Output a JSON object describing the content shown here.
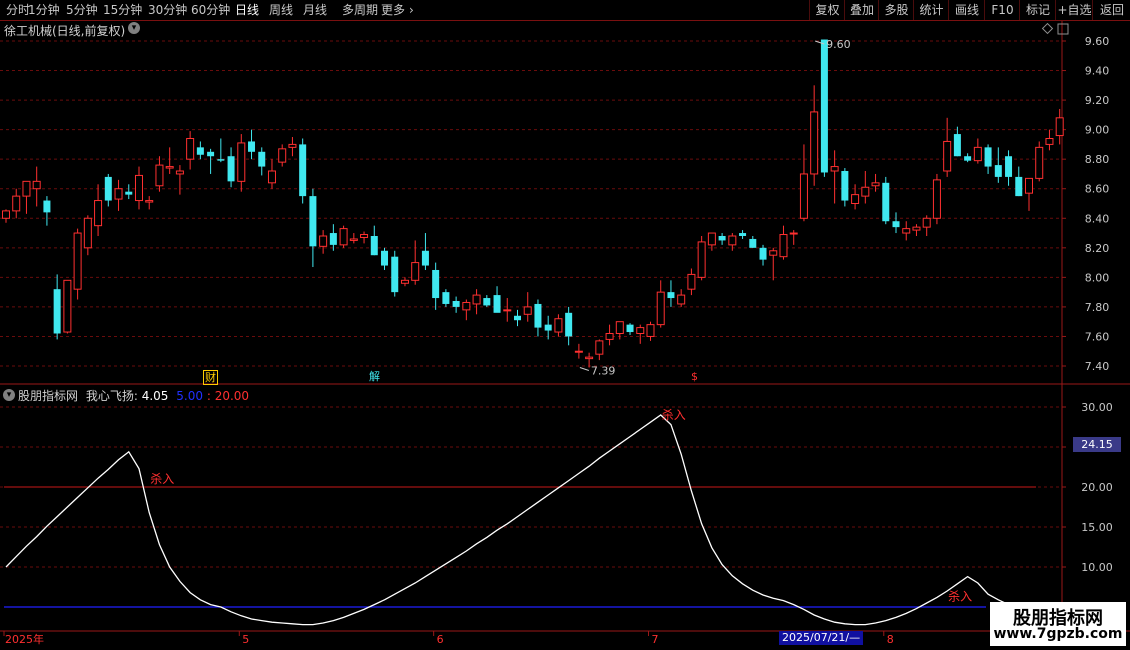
{
  "toolbar": {
    "periods": [
      "分时",
      "1分钟",
      "5分钟",
      "15分钟",
      "30分钟",
      "60分钟",
      "日线",
      "周线",
      "月线",
      "多周期",
      "更多"
    ],
    "active_period": "日线",
    "more_arrow": "›",
    "buttons": [
      "复权",
      "叠加",
      "多股",
      "统计",
      "画线",
      "F10",
      "标记",
      "+自选",
      "返回"
    ]
  },
  "stock_title": "徐工机械(日线,前复权)",
  "indicator": {
    "source": "股朋指标网",
    "name": "我心飞扬:",
    "value": "4.05",
    "param1": "5.00",
    "param2": "20.00",
    "current_value_badge": "24.15"
  },
  "watermark": {
    "line1": "股朋指标网",
    "line2": "www.7gpzb.com"
  },
  "pb_tags": {
    "cai": "财",
    "jie": "解",
    "s": "$"
  },
  "date_badge": "2025/07/21/—",
  "colors": {
    "up": "#ff3030",
    "down": "#40e8f0",
    "grid": "#6a0c0c",
    "axis": "#9a1818",
    "text": "#c8c8c8",
    "line": "#ffffff",
    "red_level": "#c81818",
    "blue_level": "#2020ff"
  },
  "chart_data": [
    {
      "type": "candlestick",
      "title": "徐工机械(日线,前复权)",
      "y_ticks": [
        7.4,
        7.6,
        7.8,
        8.0,
        8.2,
        8.4,
        8.6,
        8.8,
        9.0,
        9.2,
        9.4,
        9.6
      ],
      "ylim": [
        7.3,
        9.62
      ],
      "x_labels": [
        {
          "i": 0,
          "text": "2025年"
        },
        {
          "i": 23,
          "text": "5"
        },
        {
          "i": 42,
          "text": "6"
        },
        {
          "i": 63,
          "text": "7"
        },
        {
          "i": 86,
          "text": "8"
        }
      ],
      "annotations": [
        {
          "i": 79,
          "price": 9.6,
          "text": "9.60"
        },
        {
          "i": 56,
          "price": 7.39,
          "text": "7.39"
        }
      ],
      "ohlc": [
        [
          8.4,
          8.46,
          8.37,
          8.45
        ],
        [
          8.45,
          8.6,
          8.4,
          8.55
        ],
        [
          8.55,
          8.62,
          8.43,
          8.65
        ],
        [
          8.6,
          8.75,
          8.48,
          8.65
        ],
        [
          8.52,
          8.55,
          8.35,
          8.44
        ],
        [
          7.92,
          8.02,
          7.58,
          7.62
        ],
        [
          7.63,
          7.98,
          7.62,
          7.98
        ],
        [
          7.92,
          8.33,
          7.85,
          8.3
        ],
        [
          8.2,
          8.42,
          8.15,
          8.4
        ],
        [
          8.35,
          8.63,
          8.28,
          8.52
        ],
        [
          8.68,
          8.7,
          8.48,
          8.52
        ],
        [
          8.53,
          8.66,
          8.45,
          8.6
        ],
        [
          8.58,
          8.63,
          8.53,
          8.56
        ],
        [
          8.52,
          8.75,
          8.46,
          8.69
        ],
        [
          8.51,
          8.55,
          8.46,
          8.52
        ],
        [
          8.62,
          8.82,
          8.58,
          8.76
        ],
        [
          8.74,
          8.88,
          8.7,
          8.75
        ],
        [
          8.7,
          8.76,
          8.56,
          8.72
        ],
        [
          8.8,
          8.99,
          8.73,
          8.94
        ],
        [
          8.88,
          8.92,
          8.8,
          8.83
        ],
        [
          8.85,
          8.87,
          8.7,
          8.82
        ],
        [
          8.8,
          8.94,
          8.78,
          8.79
        ],
        [
          8.82,
          8.88,
          8.61,
          8.65
        ],
        [
          8.65,
          8.97,
          8.58,
          8.91
        ],
        [
          8.92,
          9.0,
          8.8,
          8.85
        ],
        [
          8.85,
          8.88,
          8.69,
          8.75
        ],
        [
          8.64,
          8.8,
          8.6,
          8.72
        ],
        [
          8.78,
          8.9,
          8.75,
          8.87
        ],
        [
          8.88,
          8.95,
          8.82,
          8.9
        ],
        [
          8.9,
          8.94,
          8.5,
          8.55
        ],
        [
          8.55,
          8.6,
          8.07,
          8.21
        ],
        [
          8.21,
          8.32,
          8.16,
          8.28
        ],
        [
          8.3,
          8.36,
          8.18,
          8.22
        ],
        [
          8.22,
          8.35,
          8.2,
          8.33
        ],
        [
          8.25,
          8.3,
          8.23,
          8.26
        ],
        [
          8.27,
          8.31,
          8.23,
          8.29
        ],
        [
          8.28,
          8.35,
          8.15,
          8.15
        ],
        [
          8.18,
          8.2,
          8.05,
          8.08
        ],
        [
          8.14,
          8.18,
          7.87,
          7.9
        ],
        [
          7.96,
          8.0,
          7.94,
          7.98
        ],
        [
          7.98,
          8.25,
          7.95,
          8.1
        ],
        [
          8.18,
          8.3,
          8.05,
          8.08
        ],
        [
          8.05,
          8.1,
          7.78,
          7.86
        ],
        [
          7.9,
          7.92,
          7.8,
          7.82
        ],
        [
          7.84,
          7.87,
          7.76,
          7.8
        ],
        [
          7.78,
          7.85,
          7.71,
          7.83
        ],
        [
          7.82,
          7.92,
          7.75,
          7.88
        ],
        [
          7.86,
          7.88,
          7.8,
          7.81
        ],
        [
          7.88,
          7.94,
          7.8,
          7.76
        ],
        [
          7.78,
          7.86,
          7.7,
          7.78
        ],
        [
          7.74,
          7.78,
          7.67,
          7.71
        ],
        [
          7.75,
          7.9,
          7.7,
          7.8
        ],
        [
          7.82,
          7.85,
          7.6,
          7.66
        ],
        [
          7.68,
          7.74,
          7.58,
          7.64
        ],
        [
          7.63,
          7.75,
          7.6,
          7.72
        ],
        [
          7.76,
          7.8,
          7.54,
          7.6
        ],
        [
          7.5,
          7.55,
          7.45,
          7.5
        ],
        [
          7.45,
          7.49,
          7.39,
          7.46
        ],
        [
          7.48,
          7.58,
          7.44,
          7.57
        ],
        [
          7.58,
          7.68,
          7.54,
          7.62
        ],
        [
          7.62,
          7.7,
          7.58,
          7.7
        ],
        [
          7.68,
          7.69,
          7.61,
          7.63
        ],
        [
          7.62,
          7.68,
          7.55,
          7.66
        ],
        [
          7.6,
          7.7,
          7.57,
          7.68
        ],
        [
          7.68,
          7.98,
          7.66,
          7.9
        ],
        [
          7.9,
          7.98,
          7.8,
          7.86
        ],
        [
          7.82,
          7.92,
          7.8,
          7.88
        ],
        [
          7.92,
          8.06,
          7.88,
          8.02
        ],
        [
          8.0,
          8.28,
          7.98,
          8.24
        ],
        [
          8.22,
          8.3,
          8.18,
          8.3
        ],
        [
          8.28,
          8.3,
          8.22,
          8.25
        ],
        [
          8.22,
          8.3,
          8.18,
          8.28
        ],
        [
          8.3,
          8.32,
          8.26,
          8.28
        ],
        [
          8.26,
          8.28,
          8.2,
          8.2
        ],
        [
          8.2,
          8.22,
          8.08,
          8.12
        ],
        [
          8.15,
          8.2,
          7.98,
          8.18
        ],
        [
          8.14,
          8.35,
          8.12,
          8.29
        ],
        [
          8.3,
          8.32,
          8.22,
          8.3
        ],
        [
          8.4,
          8.9,
          8.38,
          8.7
        ],
        [
          8.7,
          9.3,
          8.62,
          9.12
        ],
        [
          9.61,
          9.61,
          8.68,
          8.71
        ],
        [
          8.72,
          8.86,
          8.5,
          8.75
        ],
        [
          8.72,
          8.74,
          8.48,
          8.52
        ],
        [
          8.5,
          8.63,
          8.46,
          8.56
        ],
        [
          8.55,
          8.72,
          8.5,
          8.61
        ],
        [
          8.62,
          8.7,
          8.58,
          8.64
        ],
        [
          8.64,
          8.68,
          8.36,
          8.38
        ],
        [
          8.38,
          8.44,
          8.3,
          8.34
        ],
        [
          8.3,
          8.38,
          8.25,
          8.33
        ],
        [
          8.32,
          8.36,
          8.28,
          8.34
        ],
        [
          8.34,
          8.42,
          8.28,
          8.4
        ],
        [
          8.4,
          8.7,
          8.36,
          8.66
        ],
        [
          8.72,
          9.08,
          8.68,
          8.92
        ],
        [
          8.97,
          9.02,
          8.82,
          8.82
        ],
        [
          8.82,
          8.84,
          8.78,
          8.79
        ],
        [
          8.79,
          8.94,
          8.77,
          8.88
        ],
        [
          8.88,
          8.9,
          8.7,
          8.75
        ],
        [
          8.76,
          8.88,
          8.64,
          8.68
        ],
        [
          8.82,
          8.86,
          8.62,
          8.68
        ],
        [
          8.68,
          8.75,
          8.55,
          8.55
        ],
        [
          8.57,
          8.6,
          8.45,
          8.67
        ],
        [
          8.67,
          8.92,
          8.65,
          8.88
        ],
        [
          8.9,
          9.0,
          8.86,
          8.94
        ],
        [
          8.96,
          9.14,
          8.9,
          9.08
        ]
      ]
    },
    {
      "type": "line",
      "title": "我心飞扬",
      "y_ticks": [
        10.0,
        15.0,
        20.0,
        25.0,
        30.0
      ],
      "ylim": [
        4.0,
        31.0
      ],
      "levels": [
        20,
        5
      ],
      "annotations": [
        {
          "i": 14,
          "value": 20.5,
          "text": "杀入"
        },
        {
          "i": 64,
          "value": 28.5,
          "text": "杀入"
        },
        {
          "i": 92,
          "value": 5.8,
          "text": "杀入"
        }
      ],
      "values": [
        10.0,
        11.3,
        12.6,
        13.8,
        15.1,
        16.3,
        17.5,
        18.7,
        19.9,
        21.1,
        22.2,
        23.4,
        24.4,
        22.3,
        16.8,
        12.8,
        10.0,
        8.2,
        6.8,
        5.9,
        5.3,
        5.0,
        4.4,
        3.9,
        3.5,
        3.3,
        3.1,
        3.0,
        2.9,
        2.8,
        2.8,
        3.0,
        3.3,
        3.7,
        4.2,
        4.7,
        5.3,
        5.9,
        6.6,
        7.3,
        8.0,
        8.8,
        9.6,
        10.4,
        11.2,
        12.0,
        12.9,
        13.7,
        14.6,
        15.4,
        16.3,
        17.2,
        18.1,
        19.0,
        19.9,
        20.8,
        21.7,
        22.6,
        23.6,
        24.5,
        25.4,
        26.3,
        27.2,
        28.1,
        29.0,
        27.8,
        24.1,
        19.5,
        15.4,
        12.4,
        10.3,
        8.9,
        7.9,
        7.1,
        6.5,
        6.1,
        5.8,
        5.3,
        4.7,
        4.0,
        3.5,
        3.1,
        2.9,
        2.8,
        2.8,
        3.0,
        3.3,
        3.7,
        4.2,
        4.8,
        5.5,
        6.2,
        7.0,
        7.9,
        8.8,
        8.0,
        6.6,
        5.9,
        5.3,
        5.0,
        5.0
      ]
    }
  ]
}
